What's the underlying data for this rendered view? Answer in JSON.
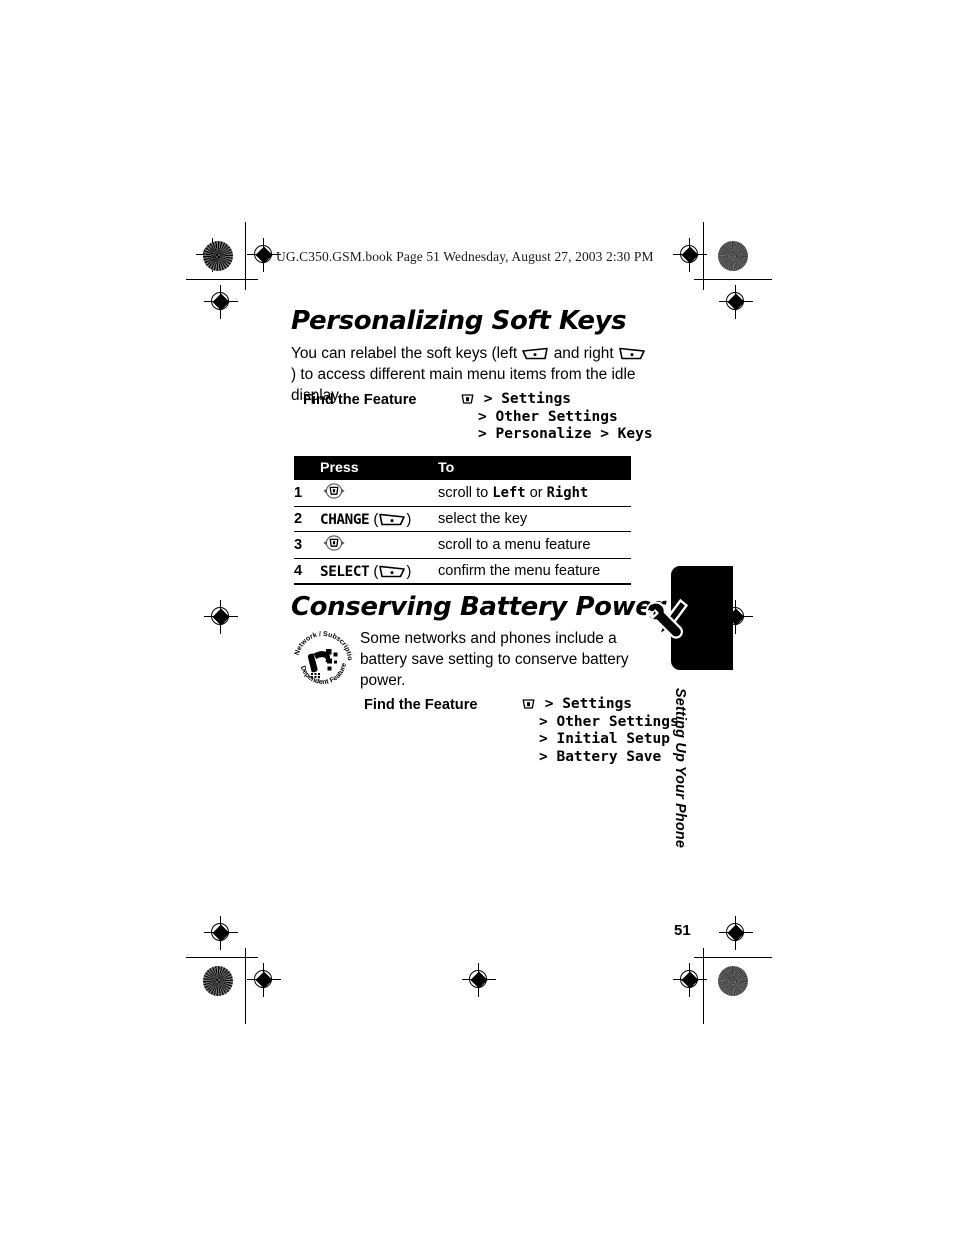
{
  "header": {
    "file_line": "UG.C350.GSM.book  Page 51  Wednesday, August 27, 2003  2:30 PM"
  },
  "sections": [
    {
      "id": "personalizing-soft-keys",
      "title": "Personalizing Soft Keys",
      "body_before_left_icon": "You can relabel the soft keys (left ",
      "body_between_icons": " and right ",
      "body_after_right_icon": ") to access different main menu items from the idle display.",
      "find_the_feature": {
        "label": "Find the Feature",
        "icon": "menu-key-icon",
        "lines": [
          "> Settings",
          "> Other Settings",
          "> Personalize > Keys"
        ]
      }
    },
    {
      "id": "conserving-battery-power",
      "title": "Conserving Battery Power",
      "badge_icon": "network-subscription-dependent-feature-icon",
      "badge_text_top": "Network / Subscription",
      "badge_text_bottom": "Dependent  Feature",
      "note": "Some networks and phones include a battery save setting to conserve battery power.",
      "find_the_feature": {
        "label": "Find the Feature",
        "icon": "menu-key-icon",
        "lines": [
          "> Settings",
          "> Other Settings",
          "> Initial Setup",
          "> Battery Save"
        ]
      }
    }
  ],
  "steps_table": {
    "headers": [
      "",
      "Press",
      "To"
    ],
    "rows": [
      {
        "num": "1",
        "press_icon": "nav-key-icon",
        "press_label": "",
        "press_softkey": "",
        "to_pre": "scroll to ",
        "to_mono1": "Left",
        "to_mid": " or ",
        "to_mono2": "Right",
        "to_post": ""
      },
      {
        "num": "2",
        "press_icon": "",
        "press_label": "CHANGE",
        "press_softkey": "right-soft-key-icon",
        "to_pre": "select the key",
        "to_mono1": "",
        "to_mid": "",
        "to_mono2": "",
        "to_post": ""
      },
      {
        "num": "3",
        "press_icon": "nav-key-icon",
        "press_label": "",
        "press_softkey": "",
        "to_pre": "scroll to a menu feature",
        "to_mono1": "",
        "to_mid": "",
        "to_mono2": "",
        "to_post": ""
      },
      {
        "num": "4",
        "press_icon": "",
        "press_label": "SELECT",
        "press_softkey": "right-soft-key-icon",
        "to_pre": "confirm the menu feature",
        "to_mono1": "",
        "to_mid": "",
        "to_mono2": "",
        "to_post": ""
      }
    ]
  },
  "side_tab": {
    "text": "Setting Up Your Phone",
    "icon": "wrench-screwdriver-icon"
  },
  "footer": {
    "page_number": "51"
  },
  "colors": {
    "ink": "#000000",
    "paper": "#ffffff",
    "header_ink": "#1a1a1a"
  }
}
